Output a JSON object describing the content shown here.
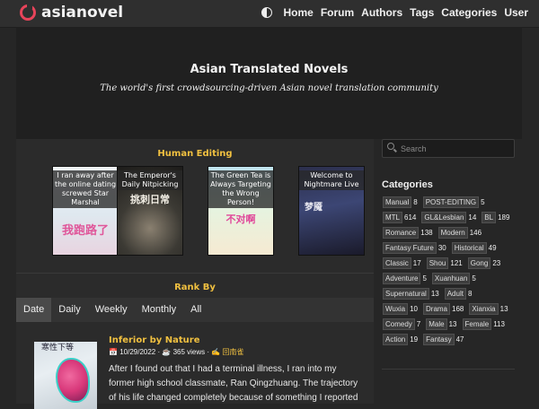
{
  "brand": {
    "name": "asianovel",
    "accent": "#e8445a"
  },
  "nav": {
    "theme_icon": "half-circle-icon",
    "items": [
      "Home",
      "Forum",
      "Authors",
      "Tags",
      "Categories",
      "User"
    ]
  },
  "hero": {
    "title": "Asian Translated Novels",
    "tagline": "The world's first crowdsourcing-driven Asian novel translation community"
  },
  "human_editing": {
    "title": "Human Editing",
    "books": [
      {
        "caption": "I ran away after the online dating screwed Star Marshal",
        "cover_text": "我跑路了"
      },
      {
        "caption": "The Emperor's Daily Nitpicking",
        "cover_text": "挑刺日常"
      },
      {
        "caption": "The Green Tea is Always Targeting the Wrong Person!",
        "cover_text": "不对啊"
      },
      {
        "caption": "Welcome to Nightmare Live",
        "cover_text": "梦魇"
      }
    ]
  },
  "rank_by": {
    "title": "Rank By",
    "tabs": [
      "Date",
      "Daily",
      "Weekly",
      "Monthly",
      "All"
    ],
    "active": "Date"
  },
  "novel": {
    "title": "Inferior by Nature",
    "date": "10/29/2022",
    "views": "365 views",
    "translator": "回南雀",
    "cover_text": "寒性下等",
    "description": "After I found out that I had a terminal illness, I ran into my former high school classmate, Ran Qingzhuang. The trajectory of his life changed completely because of something I reported"
  },
  "search": {
    "placeholder": "Search"
  },
  "categories": {
    "title": "Categories",
    "rows": [
      [
        {
          "name": "Manual",
          "count": "8"
        },
        {
          "name": "POST-EDITING",
          "count": "5"
        }
      ],
      [
        {
          "name": "MTL",
          "count": "614"
        },
        {
          "name": "GL&Lesbian",
          "count": "14"
        },
        {
          "name": "BL",
          "count": "189"
        }
      ],
      [
        {
          "name": "Romance",
          "count": "138"
        },
        {
          "name": "Modern",
          "count": "146"
        }
      ],
      [
        {
          "name": "Fantasy Future",
          "count": "30"
        },
        {
          "name": "Historical",
          "count": "49"
        }
      ],
      [
        {
          "name": "Classic",
          "count": "17"
        },
        {
          "name": "Shou",
          "count": "121"
        },
        {
          "name": "Gong",
          "count": "23"
        }
      ],
      [
        {
          "name": "Adventure",
          "count": "5"
        },
        {
          "name": "Xuanhuan",
          "count": "5"
        }
      ],
      [
        {
          "name": "Supernatural",
          "count": "13"
        },
        {
          "name": "Adult",
          "count": "8"
        }
      ],
      [
        {
          "name": "Wuxia",
          "count": "10"
        },
        {
          "name": "Drama",
          "count": "168"
        },
        {
          "name": "Xianxia",
          "count": "13"
        }
      ],
      [
        {
          "name": "Comedy",
          "count": "7"
        },
        {
          "name": "Male",
          "count": "13"
        },
        {
          "name": "Female",
          "count": "113"
        }
      ],
      [
        {
          "name": "Action",
          "count": "19"
        },
        {
          "name": "Fantasy",
          "count": "47"
        }
      ]
    ]
  }
}
